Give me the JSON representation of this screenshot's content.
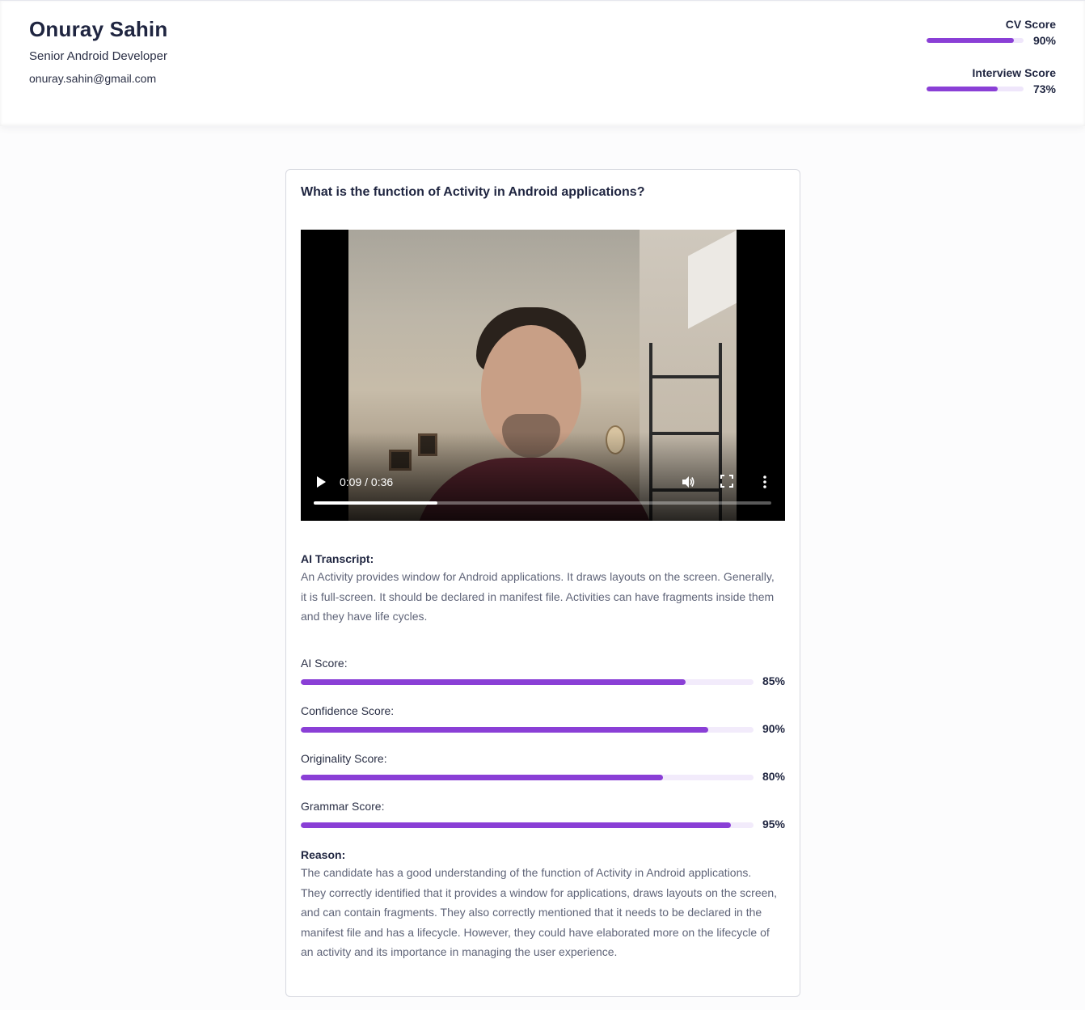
{
  "candidate": {
    "name": "Onuray Sahin",
    "title": "Senior Android Developer",
    "email": "onuray.sahin@gmail.com"
  },
  "header_scores": [
    {
      "label": "CV Score",
      "value": 90,
      "display": "90%"
    },
    {
      "label": "Interview Score",
      "value": 73,
      "display": "73%"
    }
  ],
  "question": {
    "text": "What is the function of Activity in Android applications?",
    "video": {
      "time": "0:09 / 0:36",
      "progress": 0.27,
      "icons": [
        "play-icon",
        "volume-icon",
        "fullscreen-icon",
        "more-vert-icon"
      ]
    },
    "transcript_label": "AI Transcript:",
    "transcript": "An Activity provides window for Android applications. It draws layouts on the screen. Generally, it is full-screen. It should be declared in manifest file. Activities can have fragments inside them and they have life cycles.",
    "scores": [
      {
        "label": "AI Score:",
        "value": 85,
        "display": "85%"
      },
      {
        "label": "Confidence Score:",
        "value": 90,
        "display": "90%"
      },
      {
        "label": "Originality Score:",
        "value": 80,
        "display": "80%"
      },
      {
        "label": "Grammar Score:",
        "value": 95,
        "display": "95%"
      }
    ],
    "reason_label": "Reason:",
    "reason": "The candidate has a good understanding of the function of Activity in Android applications. They correctly identified that it provides a window for applications, draws layouts on the screen, and can contain fragments. They also correctly mentioned that it needs to be declared in the manifest file and has a lifecycle. However, they could have elaborated more on the lifecycle of an activity and its importance in managing the user experience."
  },
  "colors": {
    "accent": "#8a3fd6",
    "track": "#f2ebfb",
    "text_dark": "#1f2540",
    "text_muted": "#5f6478"
  }
}
